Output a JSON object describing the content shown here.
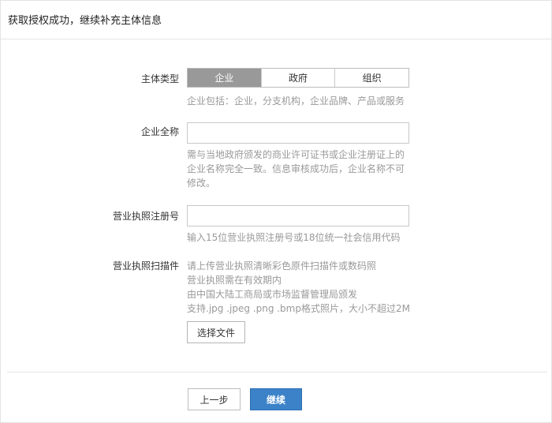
{
  "header": {
    "title": "获取授权成功，继续补充主体信息"
  },
  "form": {
    "entity_type": {
      "label": "主体类型",
      "options": [
        "企业",
        "政府",
        "组织"
      ],
      "selected": "企业",
      "hint": "企业包括：企业，分支机构，企业品牌、产品或服务"
    },
    "company_name": {
      "label": "企业全称",
      "value": "",
      "placeholder": "",
      "hint_lines": [
        "需与当地政府颁发的商业许可证书或企业注册证上的",
        "企业名称完全一致。信息审核成功后，企业名称不可",
        "修改。"
      ]
    },
    "license_number": {
      "label": "营业执照注册号",
      "value": "",
      "placeholder": "",
      "hint": "输入15位营业执照注册号或18位统一社会信用代码"
    },
    "license_scan": {
      "label": "营业执照扫描件",
      "hint_lines": [
        "请上传营业执照清晰彩色原件扫描件或数码照",
        "营业执照需在有效期内",
        "由中国大陆工商局或市场监督管理局颁发",
        "支持.jpg .jpeg .png .bmp格式照片，大小不超过2M"
      ],
      "button_label": "选择文件"
    }
  },
  "footer": {
    "prev_label": "上一步",
    "next_label": "继续"
  },
  "colors": {
    "primary": "#3b82c8",
    "segment_active": "#999999",
    "hint_text": "#999999",
    "border": "#e5e5e5"
  }
}
